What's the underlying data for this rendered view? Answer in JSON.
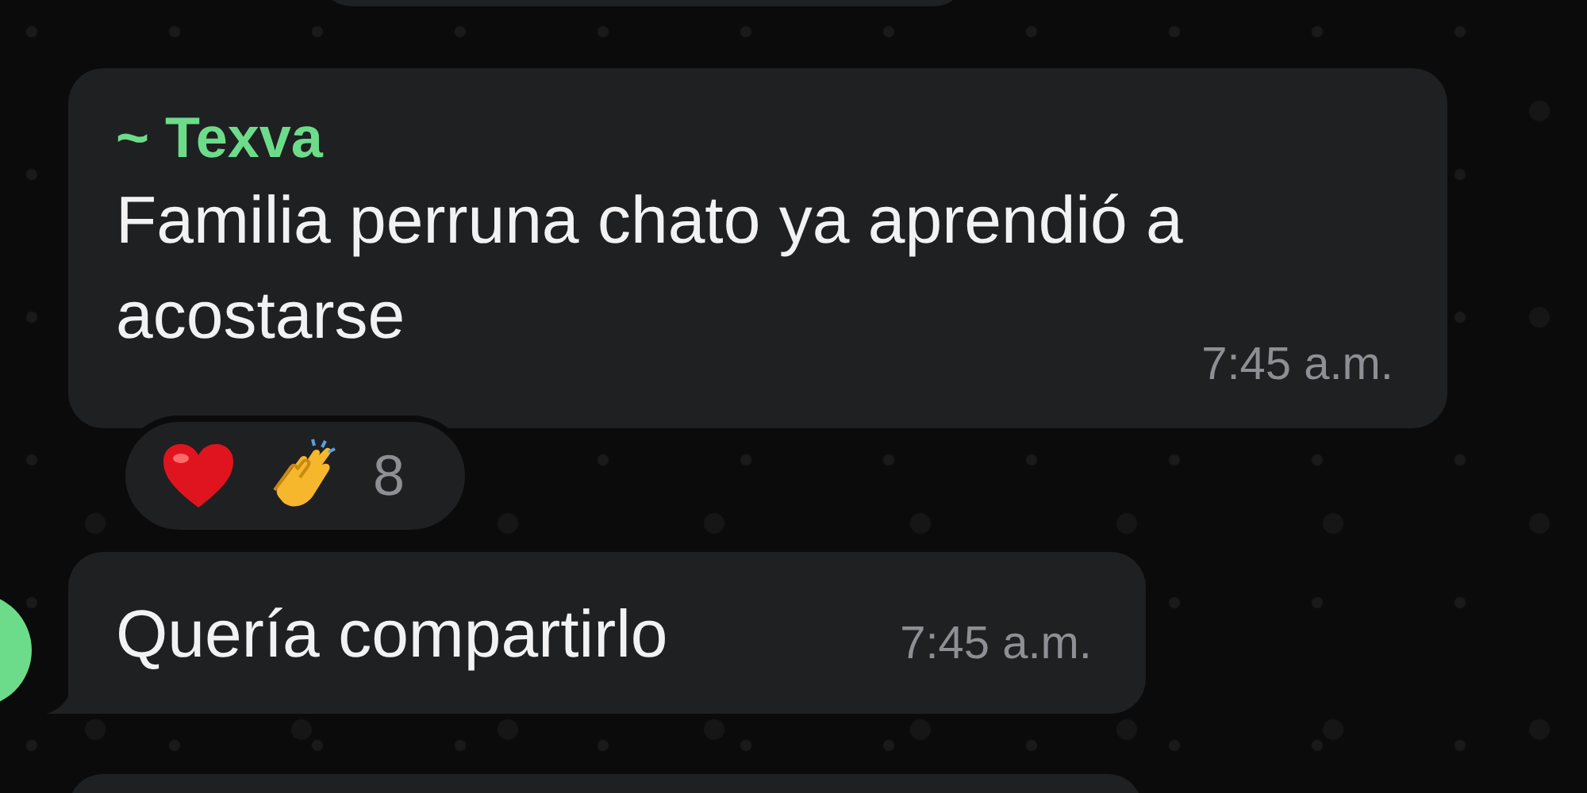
{
  "messages": [
    {
      "sender": "~ Texva",
      "text": "Familia perruna chato ya aprendió a acostarse",
      "time": "7:45 a.m.",
      "reactions": {
        "count": "8"
      }
    },
    {
      "text": "Quería compartirlo",
      "time": "7:45 a.m."
    }
  ]
}
